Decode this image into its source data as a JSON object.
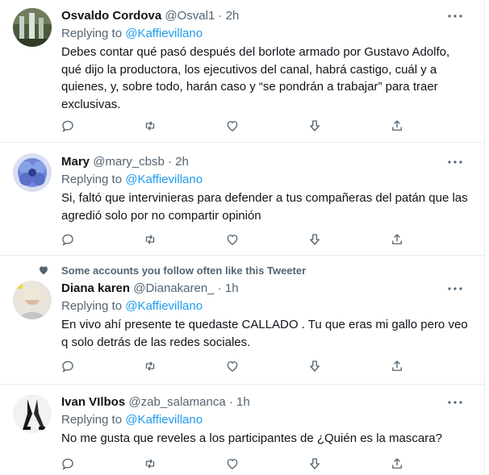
{
  "tweets": [
    {
      "name": "Osvaldo Cordova",
      "handle": "@Osval1",
      "dot": "·",
      "time": "2h",
      "replying_prefix": "Replying to ",
      "replying_to": "@Kaffievillano",
      "text": "Debes contar qué pasó después del borlote armado por Gustavo Adolfo, qué dijo la productora, los ejecutivos del canal, habrá castigo, cuál y a quienes, y, sobre todo, harán caso y “se pondrán a trabajar” para traer exclusivas."
    },
    {
      "name": "Mary",
      "handle": "@mary_cbsb",
      "dot": "·",
      "time": "2h",
      "replying_prefix": "Replying to ",
      "replying_to": "@Kaffievillano",
      "text": "Si, faltó que intervinieras para defender a tus compañeras del patán que las agredió solo por no compartir opinión"
    },
    {
      "social_context": "Some accounts you follow often like this Tweeter",
      "name": "Diana karen",
      "handle": "@Dianakaren_",
      "dot": "·",
      "time": "1h",
      "replying_prefix": "Replying to ",
      "replying_to": "@Kaffievillano",
      "text": "En vivo ahí presente te quedaste CALLADO . Tu que eras mi gallo pero veo q solo detrás de las redes sociales."
    },
    {
      "name": "Ivan VIlbos",
      "handle": "@zab_salamanca",
      "dot": "·",
      "time": "1h",
      "replying_prefix": "Replying to ",
      "replying_to": "@Kaffievillano",
      "text": "No me gusta que reveles a los participantes de ¿Quién es la mascara?"
    }
  ],
  "icons": {
    "reply": "reply-icon",
    "retweet": "retweet-icon",
    "like": "heart-icon",
    "downvote": "downvote-icon",
    "share": "share-icon",
    "more": "more-icon",
    "social": "heart-filled-icon"
  },
  "colors": {
    "link": "#1d9bf0",
    "muted": "#536471",
    "text": "#0f1419",
    "divider": "#e6ecf0"
  }
}
